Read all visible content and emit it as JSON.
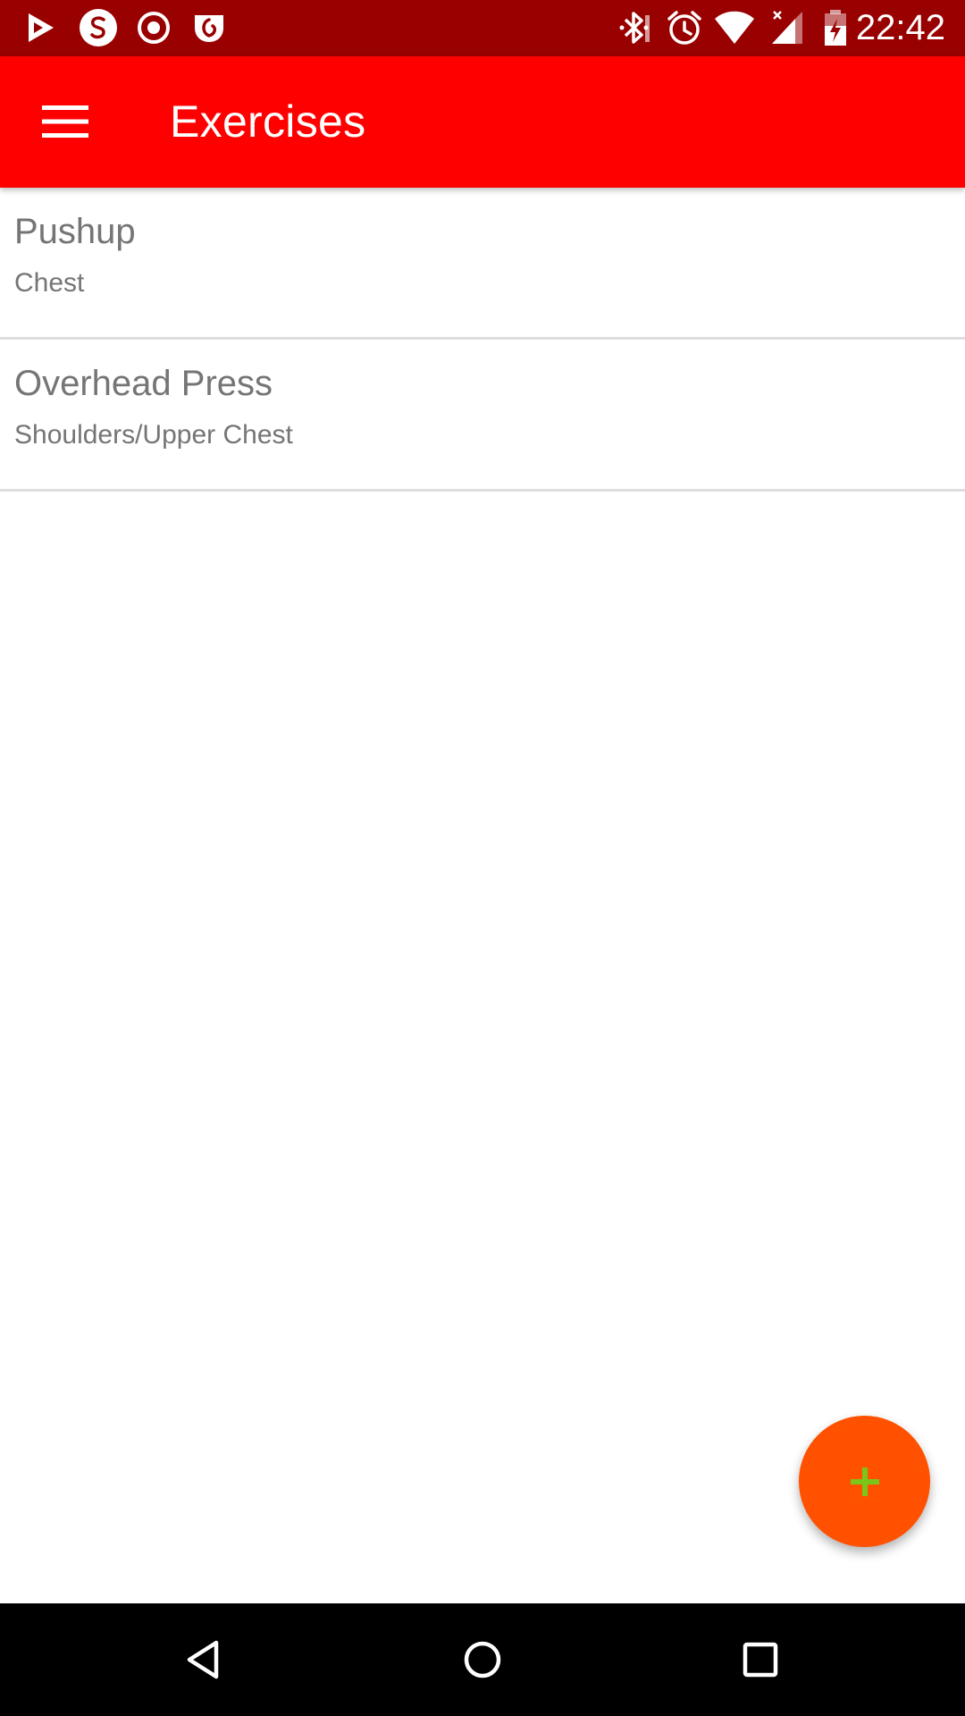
{
  "status_bar": {
    "time": "22:42",
    "left_icons": [
      "play-store-notification-icon",
      "s-app-notification-icon",
      "record-notification-icon",
      "pocket-notification-icon"
    ],
    "right_icons": [
      "bluetooth-icon",
      "alarm-icon",
      "wifi-icon",
      "cellular-signal-icon",
      "battery-charging-icon"
    ]
  },
  "app_bar": {
    "title": "Exercises",
    "background_color": "#ff0000"
  },
  "exercises": [
    {
      "name": "Pushup",
      "muscle_group": "Chest"
    },
    {
      "name": "Overhead Press",
      "muscle_group": "Shoulders/Upper Chest"
    }
  ],
  "fab": {
    "icon": "plus-icon",
    "background_color": "#ff5100",
    "icon_color": "#7cc61a"
  },
  "nav_bar": {
    "buttons": [
      "back-icon",
      "home-icon",
      "recents-icon"
    ]
  }
}
